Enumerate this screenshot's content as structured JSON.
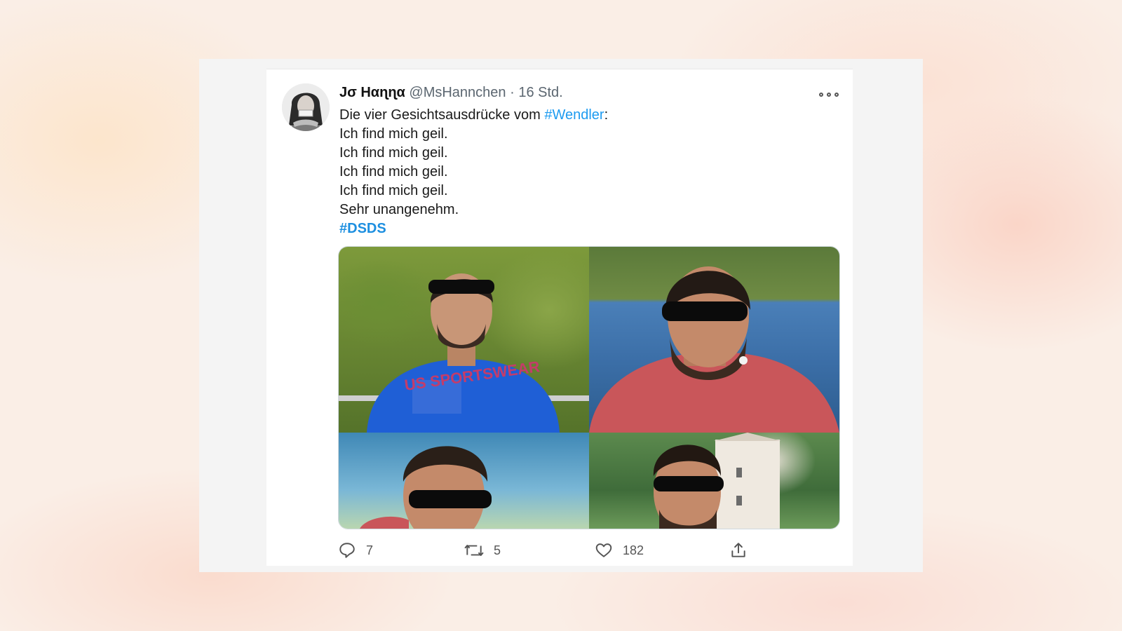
{
  "tweet": {
    "display_name": "Jσ Ηαɳɳα",
    "handle": "@MsHannchen",
    "separator": "·",
    "time": "16 Std.",
    "lines": {
      "intro": "Die vier Gesichtsausdrücke vom ",
      "intro_hashtag": "#Wendler",
      "intro_end": ":",
      "l1": "Ich find mich geil.",
      "l2": "Ich find mich geil.",
      "l3": "Ich find mich geil.",
      "l4": "Ich find mich geil.",
      "l5": "Sehr unangenehm.",
      "hashtag": "#DSDS"
    },
    "counts": {
      "replies": "7",
      "retweets": "5",
      "likes": "182"
    }
  },
  "icons": {
    "more": "more-icon",
    "reply": "reply-icon",
    "retweet": "retweet-icon",
    "like": "heart-icon",
    "share": "share-icon"
  },
  "colors": {
    "link": "#1d9bf0",
    "background": "#faeee6",
    "card": "#ffffff"
  }
}
